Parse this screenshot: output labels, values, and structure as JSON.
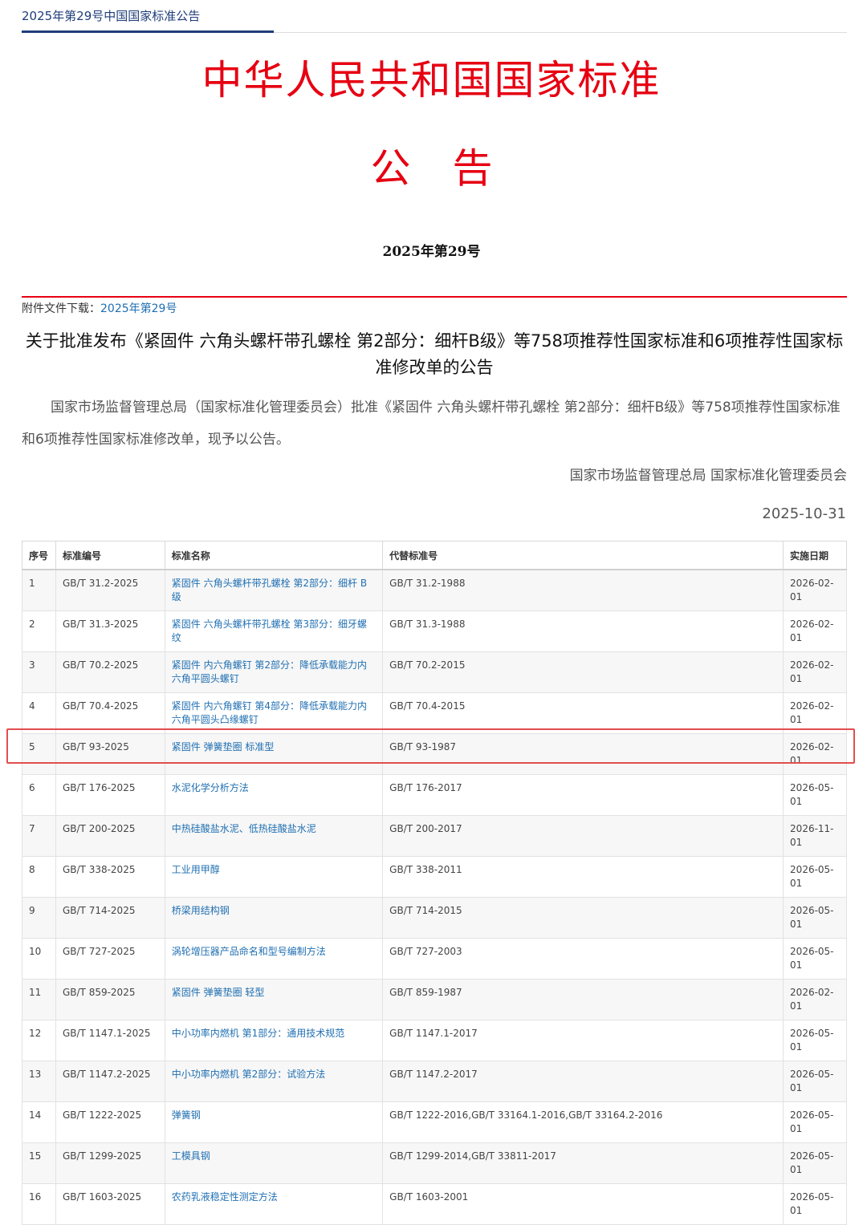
{
  "breadcrumb": "2025年第29号中国国家标准公告",
  "main_title": "中华人民共和国国家标准",
  "notice_chars": [
    "公",
    "告"
  ],
  "issue_number": "2025年第29号",
  "attachment": {
    "label": "附件文件下载：",
    "link": "2025年第29号"
  },
  "headline": "关于批准发布《紧固件 六角头螺杆带孔螺栓 第2部分：细杆B级》等758项推荐性国家标准和6项推荐性国家标准修改单的公告",
  "body": "国家市场监督管理总局（国家标准化管理委员会）批准《紧固件 六角头螺杆带孔螺栓 第2部分：细杆B级》等758项推荐性国家标准和6项推荐性国家标准修改单，现予以公告。",
  "signature": "国家市场监督管理总局 国家标准化管理委员会",
  "date": "2025-10-31",
  "table": {
    "headers": [
      "序号",
      "标准编号",
      "标准名称",
      "代替标准号",
      "实施日期"
    ],
    "rows": [
      [
        "1",
        "GB/T 31.2-2025",
        "紧固件 六角头螺杆带孔螺栓 第2部分：细杆 B级",
        "GB/T 31.2-1988",
        "2026-02-01"
      ],
      [
        "2",
        "GB/T 31.3-2025",
        "紧固件 六角头螺杆带孔螺栓 第3部分：细牙螺纹",
        "GB/T 31.3-1988",
        "2026-02-01"
      ],
      [
        "3",
        "GB/T 70.2-2025",
        "紧固件 内六角螺钉 第2部分：降低承载能力内六角平圆头螺钉",
        "GB/T 70.2-2015",
        "2026-02-01"
      ],
      [
        "4",
        "GB/T 70.4-2025",
        "紧固件 内六角螺钉 第4部分：降低承载能力内六角平圆头凸缘螺钉",
        "GB/T 70.4-2015",
        "2026-02-01"
      ],
      [
        "5",
        "GB/T 93-2025",
        "紧固件 弹簧垫圈 标准型",
        "GB/T 93-1987",
        "2026-02-01"
      ],
      [
        "6",
        "GB/T 176-2025",
        "水泥化学分析方法",
        "GB/T 176-2017",
        "2026-05-01"
      ],
      [
        "7",
        "GB/T 200-2025",
        "中热硅酸盐水泥、低热硅酸盐水泥",
        "GB/T 200-2017",
        "2026-11-01"
      ],
      [
        "8",
        "GB/T 338-2025",
        "工业用甲醇",
        "GB/T 338-2011",
        "2026-05-01"
      ],
      [
        "9",
        "GB/T 714-2025",
        "桥梁用结构钢",
        "GB/T 714-2015",
        "2026-05-01"
      ],
      [
        "10",
        "GB/T 727-2025",
        "涡轮增压器产品命名和型号编制方法",
        "GB/T 727-2003",
        "2026-05-01"
      ],
      [
        "11",
        "GB/T 859-2025",
        "紧固件 弹簧垫圈 轻型",
        "GB/T 859-1987",
        "2026-02-01"
      ],
      [
        "12",
        "GB/T 1147.1-2025",
        "中小功率内燃机 第1部分：通用技术规范",
        "GB/T 1147.1-2017",
        "2026-05-01"
      ],
      [
        "13",
        "GB/T 1147.2-2025",
        "中小功率内燃机 第2部分：试验方法",
        "GB/T 1147.2-2017",
        "2026-05-01"
      ],
      [
        "14",
        "GB/T 1222-2025",
        "弹簧钢",
        "GB/T 1222-2016,GB/T 33164.1-2016,GB/T 33164.2-2016",
        "2026-05-01"
      ],
      [
        "15",
        "GB/T 1299-2025",
        "工模具钢",
        "GB/T 1299-2014,GB/T 33811-2017",
        "2026-05-01"
      ],
      [
        "16",
        "GB/T 1603-2025",
        "农药乳液稳定性测定方法",
        "GB/T 1603-2001",
        "2026-05-01"
      ]
    ]
  },
  "highlighted_row": "6"
}
